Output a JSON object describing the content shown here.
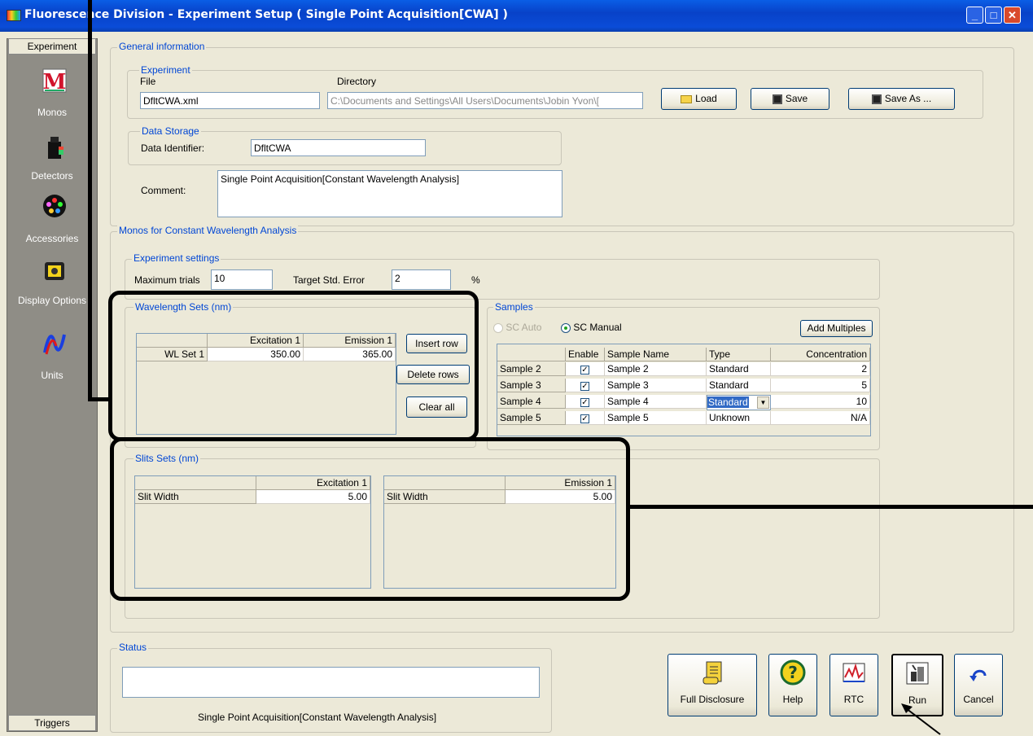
{
  "window": {
    "title": "Fluorescence Division - Experiment Setup ( Single Point Acquisition[CWA] )",
    "controls": [
      "minimize",
      "maximize",
      "close"
    ]
  },
  "sidebar": {
    "top_tab": "Experiment",
    "bottom_tab": "Triggers",
    "items": [
      {
        "label": "Monos",
        "icon": "monos-icon"
      },
      {
        "label": "Detectors",
        "icon": "detector-icon"
      },
      {
        "label": "Accessories",
        "icon": "accessories-icon"
      },
      {
        "label": "Display Options",
        "icon": "display-icon"
      },
      {
        "label": "Units",
        "icon": "units-icon"
      }
    ]
  },
  "general": {
    "legend": "General information",
    "experiment": {
      "legend": "Experiment",
      "file_label": "File",
      "file_value": "DfltCWA.xml",
      "directory_label": "Directory",
      "directory_value": "C:\\Documents and Settings\\All Users\\Documents\\Jobin Yvon\\[",
      "load_label": "Load",
      "save_label": "Save",
      "save_as_label": "Save As ..."
    },
    "data_storage": {
      "legend": "Data Storage",
      "identifier_label": "Data Identifier:",
      "identifier_value": "DfltCWA"
    },
    "comment_label": "Comment:",
    "comment_value": "Single Point Acquisition[Constant Wavelength Analysis]"
  },
  "monos": {
    "legend": "Monos for Constant Wavelength Analysis",
    "settings": {
      "legend": "Experiment settings",
      "max_trials_label": "Maximum trials",
      "max_trials_value": "10",
      "target_error_label": "Target Std. Error",
      "target_error_value": "2",
      "percent": "%"
    },
    "wavelength": {
      "legend": "Wavelength Sets (nm)",
      "columns": [
        "",
        "Excitation 1",
        "Emission 1"
      ],
      "rows": [
        [
          "WL Set 1",
          "350.00",
          "365.00"
        ]
      ],
      "insert_label": "Insert row",
      "delete_label": "Delete rows",
      "clear_label": "Clear all"
    },
    "samples": {
      "legend": "Samples",
      "sc_auto": "SC Auto",
      "sc_manual": "SC Manual",
      "mode": "SC Manual",
      "add_multiples": "Add Multiples",
      "columns": [
        "",
        "Enable",
        "Sample Name",
        "Type",
        "Concentration"
      ],
      "rows": [
        {
          "id": "Sample 2",
          "enabled": true,
          "name": "Sample 2",
          "type": "Standard",
          "conc": "2"
        },
        {
          "id": "Sample 3",
          "enabled": true,
          "name": "Sample 3",
          "type": "Standard",
          "conc": "5"
        },
        {
          "id": "Sample 4",
          "enabled": true,
          "name": "Sample 4",
          "type": "Standard",
          "conc": "10"
        },
        {
          "id": "Sample 5",
          "enabled": true,
          "name": "Sample 5",
          "type": "Unknown",
          "conc": "N/A"
        }
      ],
      "check": "✓"
    },
    "slits": {
      "legend": "Slits Sets (nm)",
      "excitation_header": "Excitation 1",
      "emission_header": "Emission 1",
      "row_label": "Slit Width",
      "excitation_value": "5.00",
      "emission_value": "5.00"
    }
  },
  "status": {
    "legend": "Status",
    "text": "Single Point Acquisition[Constant Wavelength Analysis]"
  },
  "actions": {
    "full_disclosure": "Full Disclosure",
    "help": "Help",
    "rtc": "RTC",
    "run": "Run",
    "cancel": "Cancel"
  }
}
